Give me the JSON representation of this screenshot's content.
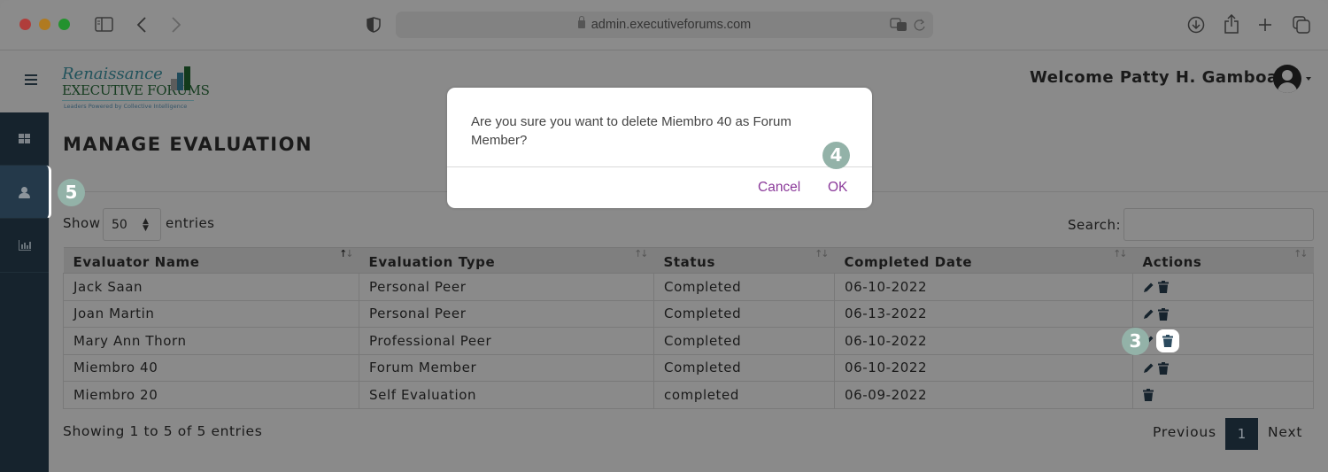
{
  "browser": {
    "url": "admin.executiveforums.com",
    "icons": [
      "sidebar-toggle-icon",
      "back-icon",
      "forward-icon",
      "shield-icon",
      "translate-icon",
      "reload-icon",
      "download-icon",
      "share-icon",
      "new-tab-icon",
      "tabs-overview-icon"
    ]
  },
  "header": {
    "logo": {
      "line1": "Renaissance",
      "line2": "EXECUTIVE FORUMS",
      "tagline": "Leaders Powered by Collective Intelligence"
    },
    "welcome": "Welcome Patty H. Gamboa"
  },
  "sidebar": {
    "items": [
      {
        "name": "dashboard",
        "icon": "grid-icon",
        "active": false
      },
      {
        "name": "members",
        "icon": "user-icon",
        "active": true
      },
      {
        "name": "reports",
        "icon": "bar-chart-icon",
        "active": false
      }
    ]
  },
  "page": {
    "title": "MANAGE EVALUATION",
    "show_label": "Show",
    "page_size": "50",
    "entries_label": "entries",
    "search_label": "Search:",
    "search_value": ""
  },
  "table": {
    "columns": [
      "Evaluator Name",
      "Evaluation Type",
      "Status",
      "Completed Date",
      "Actions"
    ],
    "sorted_column": "Evaluator Name",
    "sort_direction": "ascending",
    "rows": [
      {
        "name": "Jack Saan",
        "type": "Personal Peer",
        "status": "Completed",
        "date": "06-10-2022",
        "actions": [
          "edit",
          "delete"
        ]
      },
      {
        "name": "Joan Martin",
        "type": "Personal Peer",
        "status": "Completed",
        "date": "06-13-2022",
        "actions": [
          "edit",
          "delete"
        ]
      },
      {
        "name": "Mary Ann Thorn",
        "type": "Professional Peer",
        "status": "Completed",
        "date": "06-10-2022",
        "actions": [
          "edit",
          "delete"
        ]
      },
      {
        "name": "Miembro 40",
        "type": "Forum Member",
        "status": "Completed",
        "date": "06-10-2022",
        "actions": [
          "edit",
          "delete"
        ]
      },
      {
        "name": "Miembro 20",
        "type": "Self Evaluation",
        "status": "completed",
        "date": "06-09-2022",
        "actions": [
          "delete"
        ]
      }
    ]
  },
  "footer": {
    "info": "Showing 1 to 5 of 5 entries",
    "previous": "Previous",
    "current_page": "1",
    "next": "Next"
  },
  "modal": {
    "message": "Are you sure you want to delete Miembro  40 as Forum Member?",
    "cancel": "Cancel",
    "ok": "OK"
  },
  "badges": {
    "b3": "3",
    "b4": "4",
    "b5": "5"
  },
  "colors": {
    "sidebar": "#16232d",
    "modal_action": "#8b3a9a",
    "badge": "#93b2a8"
  }
}
